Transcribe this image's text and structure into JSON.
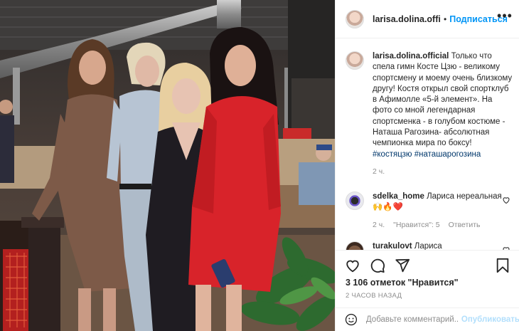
{
  "post": {
    "username": "larisa.dolina.officia",
    "follow_label": "Подписаться",
    "more_label": "•••",
    "separator": "•",
    "photo_alt": "Фото публикации larisa.dolina.official"
  },
  "caption": {
    "username": "larisa.dolina.official",
    "text": " Только что спела гимн Косте Цзю - великому спортсмену и моему очень близкому другу! Костя открыл свой спортклуб в Афимолле «5-й элемент». На фото со мной легендарная спортсменка - в голубом костюме - Наташа Рагозина- абсолютная чемпионка мира по боксу!",
    "hashtag1": "#костяцзю",
    "hashtag2": "#наташарогозина",
    "time": "2 ч."
  },
  "comments": [
    {
      "username": "sdelka_home",
      "text": " Лариса нереальная 🙌🔥❤️",
      "time": "2 ч.",
      "likes": "\"Нравится\": 5",
      "reply": "Ответить"
    },
    {
      "username": "turakulovt",
      "text": " Лариса"
    }
  ],
  "actions": {
    "likes": "3 106 отметок \"Нравится\"",
    "time": "2 ЧАСОВ НАЗАД"
  },
  "add_comment": {
    "placeholder": "Добавьте комментарий...",
    "publish": "Опубликовать"
  },
  "colors": {
    "accent": "#0095f6",
    "hashtag": "#00376b",
    "muted": "#8e8e8e",
    "red_dress": "#d8232a"
  }
}
